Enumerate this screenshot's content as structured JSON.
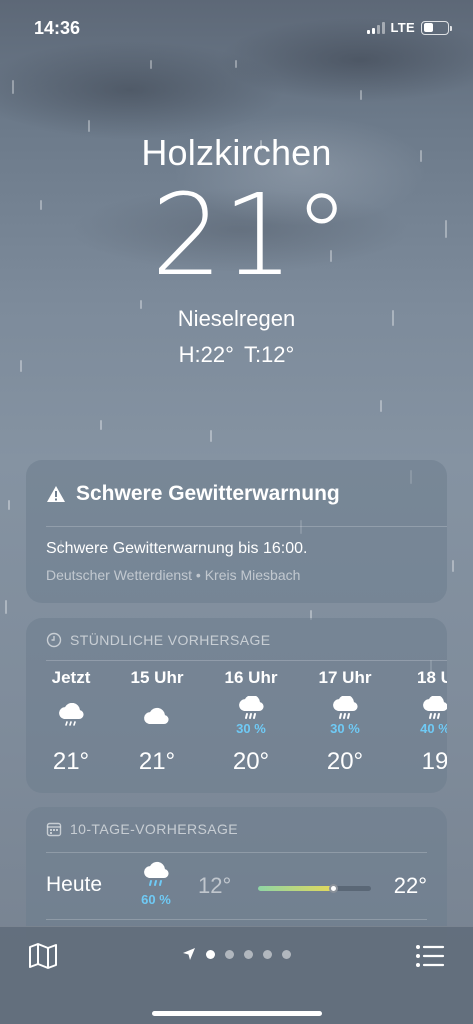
{
  "status_bar": {
    "time": "14:36",
    "network": "LTE"
  },
  "location": {
    "city": "Holzkirchen",
    "temperature": "21°",
    "condition": "Nieselregen",
    "high": "H:22°",
    "low": "T:12°"
  },
  "alert": {
    "title": "Schwere Gewitterwarnung",
    "text": "Schwere Gewitterwarnung bis 16:00.",
    "source": "Deutscher Wetterdienst • Kreis Miesbach"
  },
  "hourly": {
    "header": "STÜNDLICHE VORHERSAGE",
    "items": [
      {
        "label": "Jetzt",
        "icon": "drizzle-icon",
        "precip": "",
        "temp": "21°"
      },
      {
        "label": "15 Uhr",
        "icon": "cloud-icon",
        "precip": "",
        "temp": "21°"
      },
      {
        "label": "16 Uhr",
        "icon": "rain-icon",
        "precip": "30 %",
        "temp": "20°"
      },
      {
        "label": "17 Uhr",
        "icon": "rain-icon",
        "precip": "30 %",
        "temp": "20°"
      },
      {
        "label": "18 U",
        "icon": "rain-icon",
        "precip": "40 %",
        "temp": "19"
      }
    ]
  },
  "daily": {
    "header": "10-TAGE-VORHERSAGE",
    "items": [
      {
        "day": "Heute",
        "icon": "rain-icon",
        "precip": "60 %",
        "low": "12°",
        "high": "22°",
        "current_fraction": 0.6
      }
    ]
  },
  "bottom_bar": {
    "page_count": 5,
    "active_page": 0
  },
  "colors": {
    "precip_blue": "#6fcaf5",
    "bar_start": "#8fd5a5",
    "bar_end": "#e3d95b"
  }
}
